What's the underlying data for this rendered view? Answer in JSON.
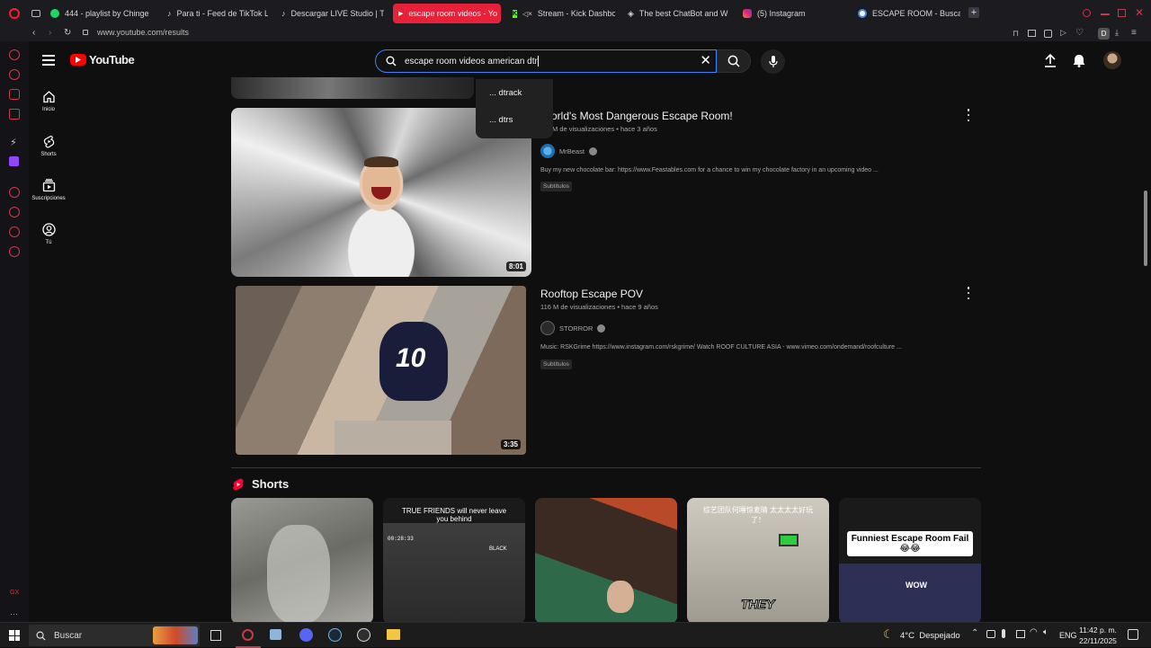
{
  "browser": {
    "tabs": [
      {
        "label": "444 - playlist by Chinge",
        "color": "#1ed760"
      },
      {
        "label": "Para ti - Feed de TikTok L",
        "color": "#ffffff"
      },
      {
        "label": "Descargar LIVE Studio | T",
        "color": "#ffffff"
      },
      {
        "label": "escape room videos - Yo",
        "color": "#ffffff"
      },
      {
        "label": "Stream - Kick Dashbo",
        "color": "#53fc18"
      },
      {
        "label": "The best ChatBot and W",
        "color": "#ffffff"
      },
      {
        "label": "(5) Instagram",
        "color": "#e1306c"
      },
      {
        "label": "ESCAPE ROOM - Buscar c",
        "color": "#4285f4"
      }
    ],
    "url": "www.youtube.com/results"
  },
  "header": {
    "logo_text": "YouTube",
    "search_value": "escape room videos american dtr",
    "suggestions": [
      "... dtrack",
      "... dtrs"
    ]
  },
  "guide": {
    "items": [
      {
        "label": "Inicio",
        "icon": "home-icon"
      },
      {
        "label": "Shorts",
        "icon": "shorts-icon"
      },
      {
        "label": "Suscripciones",
        "icon": "subscriptions-icon"
      },
      {
        "label": "Tú",
        "icon": "you-icon"
      }
    ]
  },
  "results": [
    {
      "title": "orld's Most Dangerous Escape Room!",
      "meta": "M de visualizaciones • hace 3 años",
      "channel": "MrBeast",
      "description": "Buy my new chocolate bar: https://www.Feastables.com for a chance to win my chocolate factory in an upcoming video ...",
      "badge": "Subtítulos",
      "duration": "8:01"
    },
    {
      "title": "Rooftop Escape POV",
      "meta": "116 M de visualizaciones • hace 9 años",
      "channel": "STORROR",
      "description": "Music: RSKGrime https://www.instagram.com/rskgrime/ Watch ROOF CULTURE ASIA - www.vimeo.com/ondemand/roofculture ...",
      "badge": "Subtítulos",
      "duration": "3:35"
    }
  ],
  "shorts": {
    "heading": "Shorts",
    "items": [
      {
        "overlay": "",
        "accent": "#8b8b85"
      },
      {
        "overlay": "TRUE FRIENDS will never leave you behind",
        "accent": "#3a3a3a"
      },
      {
        "overlay": "",
        "accent": "#7a2c22"
      },
      {
        "overlay": "THEY",
        "accent": "#b7b2a8"
      },
      {
        "overlay": "Funniest Escape Room Fail 😂😂",
        "accent": "#3c3f6a"
      }
    ],
    "short2_sub": "BLACK",
    "short2_time": "00:28:33",
    "short4_chinese": "综艺团队何睡惊麦睛 太太太太好玩了！",
    "short5_word": "WOW"
  },
  "taskbar": {
    "search_label": "Buscar",
    "weather": "4°C  Despejado",
    "lang": "ENG",
    "time": "11:42 p. m.",
    "date": "22/11/2025"
  }
}
